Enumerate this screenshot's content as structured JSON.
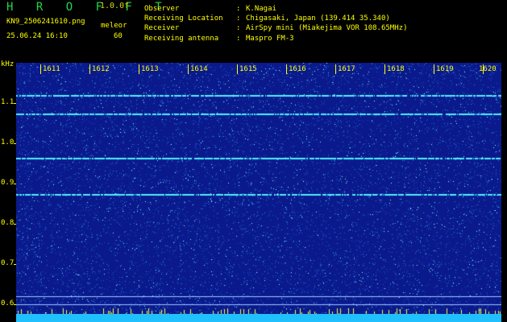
{
  "header": {
    "app_title": "H R O F F T",
    "version": "1.0.0f",
    "filename": "KN9_2506241610.png",
    "timestamp": "25.06.24 16:10",
    "mode_label": "meleor",
    "mode_value": "60"
  },
  "info": [
    {
      "key": "Observer",
      "value": "K.Nagai"
    },
    {
      "key": "Receiving Location",
      "value": "Chigasaki, Japan (139.414 35.340)"
    },
    {
      "key": "Receiver",
      "value": "AirSpy mini (Miakejima VOR 108.65MHz)"
    },
    {
      "key": "Receiving antenna",
      "value": "Maspro FM-3"
    }
  ],
  "info_separator": ":",
  "axes": {
    "y_unit": "kHz",
    "y_ticks": [
      "1.1",
      "1.0",
      "0.9",
      "0.8",
      "0.7",
      "0.6"
    ],
    "x_ticks": [
      "1611",
      "1612",
      "1613",
      "1614",
      "1615",
      "1616",
      "1617",
      "1618",
      "1619",
      "1620"
    ]
  },
  "spectrogram": {
    "background_color": "#0a1a8c",
    "noise_color": "#3ad0ff",
    "trace_color": "#50f0ff",
    "bottom_bar_color": "#20c0ff",
    "horizontal_traces_khz": [
      1.12,
      1.075,
      0.965,
      0.875
    ],
    "reference_lines_khz": [
      0.62,
      0.6
    ]
  }
}
